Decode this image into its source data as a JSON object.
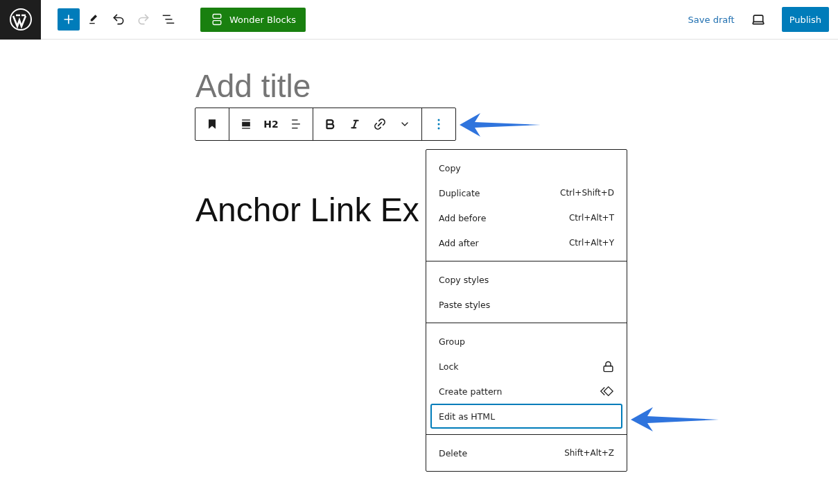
{
  "top_bar": {
    "tools": [
      {
        "kind": "add",
        "disabled": false
      },
      {
        "kind": "pen",
        "disabled": false
      },
      {
        "kind": "undo",
        "disabled": false
      },
      {
        "kind": "redo",
        "disabled": true
      },
      {
        "kind": "list",
        "disabled": false
      }
    ],
    "plugin_button": "Wonder Blocks",
    "save_draft": "Save draft",
    "publish": "Publish"
  },
  "editor": {
    "title_placeholder": "Add title",
    "heading": "Anchor Link Ex"
  },
  "block_toolbar": {
    "groups": [
      [
        {
          "kind": "bookmark"
        }
      ],
      [
        {
          "kind": "align"
        },
        {
          "kind": "text",
          "label": "H2"
        },
        {
          "kind": "text-align"
        }
      ],
      [
        {
          "kind": "bold"
        },
        {
          "kind": "italic"
        },
        {
          "kind": "link"
        },
        {
          "kind": "more"
        }
      ],
      [
        {
          "kind": "options"
        }
      ]
    ]
  },
  "menu": {
    "groups": [
      [
        {
          "label": "Copy",
          "selected": false
        },
        {
          "label": "Duplicate",
          "shortcut": "Ctrl+Shift+D",
          "selected": false
        },
        {
          "label": "Add before",
          "shortcut": "Ctrl+Alt+T",
          "selected": false
        },
        {
          "label": "Add after",
          "shortcut": "Ctrl+Alt+Y",
          "selected": false
        }
      ],
      [
        {
          "label": "Copy styles",
          "selected": false
        },
        {
          "label": "Paste styles",
          "selected": false
        }
      ],
      [
        {
          "label": "Group",
          "selected": false
        },
        {
          "label": "Lock",
          "selected": false
        },
        {
          "label": "Create pattern",
          "selected": false
        },
        {
          "label": "Edit as HTML",
          "selected": true
        }
      ],
      [
        {
          "label": "Delete",
          "shortcut": "Shift+Alt+Z",
          "selected": false
        }
      ]
    ]
  }
}
